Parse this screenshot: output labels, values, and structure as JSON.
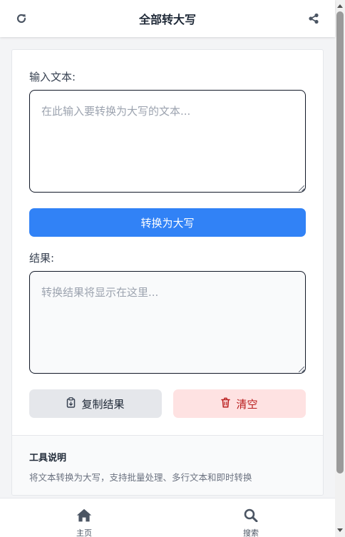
{
  "header": {
    "title": "全部转大写",
    "left_icon": "refresh-icon",
    "right_icon": "share-icon"
  },
  "converter": {
    "input_label": "输入文本:",
    "input_placeholder": "在此输入要转换为大写的文本...",
    "input_value": "",
    "convert_label": "转换为大写",
    "result_label": "结果:",
    "result_placeholder": "转换结果将显示在这里...",
    "result_value": "",
    "copy_label": "复制结果",
    "copy_icon": "clipboard-icon",
    "clear_label": "清空",
    "clear_icon": "trash-icon"
  },
  "info": {
    "title": "工具说明",
    "description": "将文本转换为大写，支持批量处理、多行文本和即时转换"
  },
  "nav": {
    "items": [
      {
        "label": "主页",
        "icon": "home-icon"
      },
      {
        "label": "搜索",
        "icon": "search-icon"
      }
    ]
  },
  "colors": {
    "primary": "#3182f6",
    "clear_bg": "#fee2e2",
    "clear_text": "#b91c1c",
    "copy_bg": "#e5e7eb"
  }
}
